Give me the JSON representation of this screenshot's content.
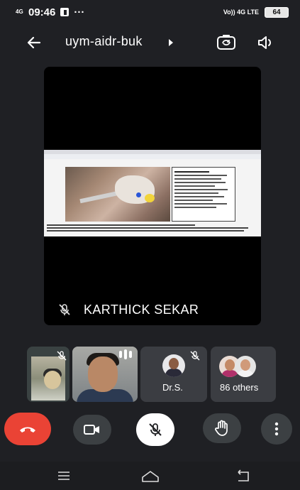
{
  "status_bar": {
    "network": "4G",
    "time": "09:46",
    "notifications": "···",
    "carrier_tag": "Vo)) 4G LTE",
    "battery": "64"
  },
  "header": {
    "meeting_code": "uym-aidr-buk",
    "back_icon": "arrow-left-icon",
    "switch_camera_icon": "switch-camera-icon",
    "speaker_icon": "speaker-icon"
  },
  "main_tile": {
    "participant_name": "KARTHICK SEKAR",
    "muted": true
  },
  "participants": [
    {
      "label": "",
      "muted": true
    },
    {
      "label": "",
      "speaking": true
    },
    {
      "label": "Dr.S.",
      "muted": true
    },
    {
      "label": "86 others"
    }
  ],
  "controls": {
    "end_call_icon": "end-call-icon",
    "camera_icon": "video-camera-icon",
    "mic_icon": "mic-off-icon",
    "hand_icon": "raise-hand-icon",
    "more_icon": "more-vertical-icon"
  },
  "colors": {
    "background": "#1f2024",
    "end_call": "#ea4335",
    "control_bg": "#3c4043",
    "mic_active_bg": "#ffffff"
  }
}
